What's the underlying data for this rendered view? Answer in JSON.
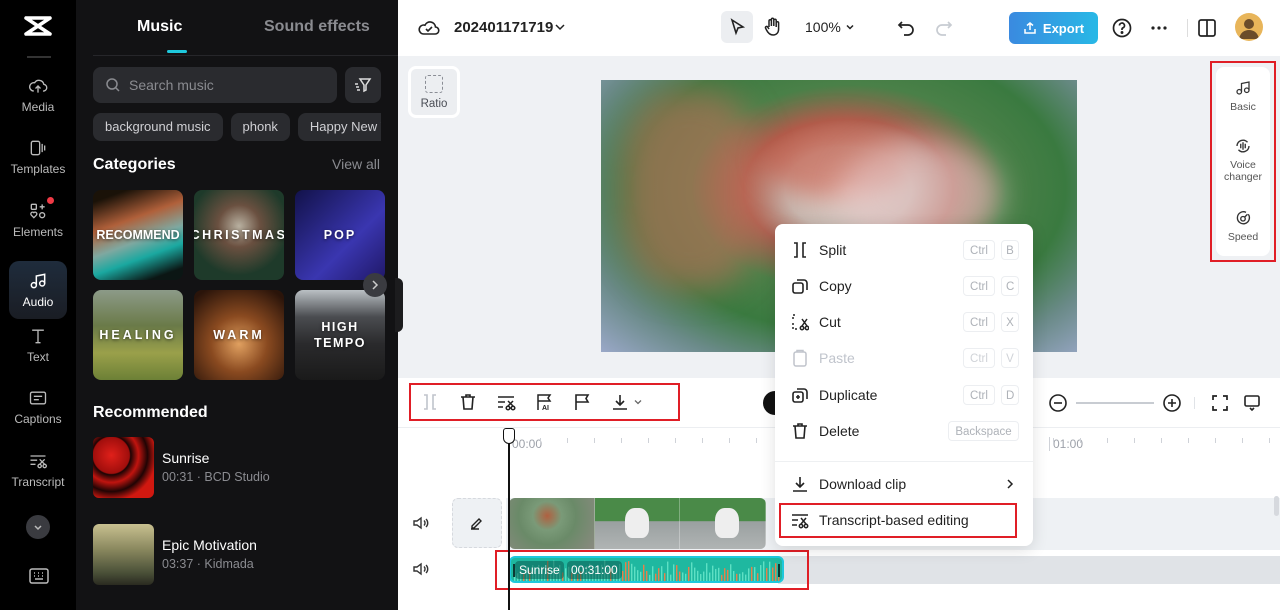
{
  "rail": {
    "items": [
      {
        "label": "Media",
        "icon": "cloud-upload-icon"
      },
      {
        "label": "Templates",
        "icon": "templates-icon"
      },
      {
        "label": "Elements",
        "icon": "elements-icon",
        "badge": true
      },
      {
        "label": "Audio",
        "icon": "music-note-icon",
        "active": true
      },
      {
        "label": "Text",
        "icon": "text-icon"
      },
      {
        "label": "Captions",
        "icon": "captions-icon"
      },
      {
        "label": "Transcript",
        "icon": "transcript-icon"
      }
    ]
  },
  "panel": {
    "tabs": [
      "Music",
      "Sound effects"
    ],
    "active_tab": "Music",
    "search_placeholder": "Search music",
    "chips": [
      "background music",
      "phonk",
      "Happy New Year"
    ],
    "categories_title": "Categories",
    "view_all": "View all",
    "categories": [
      "RECOMMEND",
      "CHRISTMAS",
      "POP",
      "HEALING",
      "WARM",
      "HIGH TEMPO"
    ],
    "recommended_title": "Recommended",
    "songs": [
      {
        "title": "Sunrise",
        "meta": "00:31 · BCD Studio"
      },
      {
        "title": "Epic Motivation",
        "meta": "03:37 · Kidmada"
      }
    ]
  },
  "topbar": {
    "project_name": "202401171719",
    "zoom": "100%",
    "export_label": "Export"
  },
  "workspace": {
    "ratio_label": "Ratio"
  },
  "right_panel": {
    "items": [
      "Basic",
      "Voice changer",
      "Speed"
    ]
  },
  "timeline": {
    "ruler_labels": [
      "00:00",
      "01:00"
    ],
    "audio_clip": {
      "name": "Sunrise",
      "duration": "00:31:00",
      "color": "#1fb8a0"
    }
  },
  "context_menu": {
    "items": [
      {
        "label": "Split",
        "keys": [
          "Ctrl",
          "B"
        ],
        "icon": "split-icon"
      },
      {
        "label": "Copy",
        "keys": [
          "Ctrl",
          "C"
        ],
        "icon": "copy-icon"
      },
      {
        "label": "Cut",
        "keys": [
          "Ctrl",
          "X"
        ],
        "icon": "cut-icon"
      },
      {
        "label": "Paste",
        "keys": [
          "Ctrl",
          "V"
        ],
        "icon": "paste-icon",
        "disabled": true
      },
      {
        "label": "Duplicate",
        "keys": [
          "Ctrl",
          "D"
        ],
        "icon": "duplicate-icon"
      },
      {
        "label": "Delete",
        "keys": [
          "Backspace"
        ],
        "icon": "trash-icon"
      },
      {
        "label": "Download clip",
        "icon": "download-icon",
        "submenu": true
      },
      {
        "label": "Transcript-based editing",
        "icon": "transcript-icon",
        "highlighted": true
      }
    ]
  },
  "colors": {
    "accent": "#1ec8dc",
    "highlight_box": "#e01e26",
    "export_start": "#3a8ae0",
    "export_end": "#28b8e6"
  }
}
